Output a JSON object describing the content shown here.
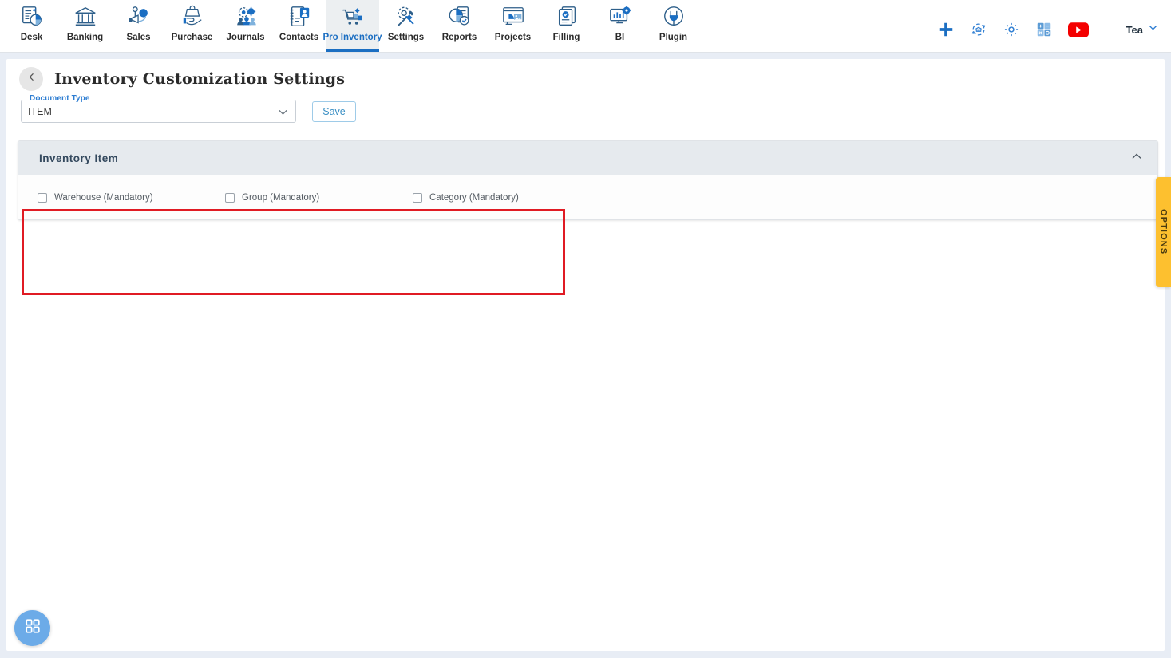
{
  "topnav": {
    "items": [
      {
        "label": "Desk",
        "icon": "desk-chart-icon",
        "active": false
      },
      {
        "label": "Banking",
        "icon": "bank-building-icon",
        "active": false
      },
      {
        "label": "Sales",
        "icon": "megaphone-sales-icon",
        "active": false
      },
      {
        "label": "Purchase",
        "icon": "purchase-hand-bag-icon",
        "active": false
      },
      {
        "label": "Journals",
        "icon": "journals-gear-people-icon",
        "active": false
      },
      {
        "label": "Contacts",
        "icon": "contacts-book-icon",
        "active": false
      },
      {
        "label": "Pro Inventory",
        "icon": "inventory-cart-icon",
        "active": true
      },
      {
        "label": "Settings",
        "icon": "settings-tools-icon",
        "active": false
      },
      {
        "label": "Reports",
        "icon": "reports-pie-doc-icon",
        "active": false
      },
      {
        "label": "Projects",
        "icon": "projects-board-icon",
        "active": false
      },
      {
        "label": "Filling",
        "icon": "filling-docs-icon",
        "active": false
      },
      {
        "label": "BI",
        "icon": "bi-monitor-icon",
        "active": false
      },
      {
        "label": "Plugin",
        "icon": "plugin-plug-icon",
        "active": false
      }
    ],
    "right_icons": [
      {
        "name": "add-plus-icon",
        "color": "#1b6ec2"
      },
      {
        "name": "bank-sync-icon",
        "color": "#2d7dd2"
      },
      {
        "name": "gear-settings-icon",
        "color": "#2d7dd2"
      },
      {
        "name": "calculator-icon",
        "color": "#5b9bd5"
      },
      {
        "name": "youtube-icon",
        "color": "#f40000"
      }
    ],
    "user": {
      "name": "Tea",
      "chevron": "chevron-down-icon"
    }
  },
  "page": {
    "back_icon": "chevron-left-icon",
    "title": "Inventory Customization Settings",
    "document_type": {
      "label": "Document Type",
      "value": "ITEM",
      "chevron": "chevron-down-icon"
    },
    "save_label": "Save"
  },
  "card": {
    "title": "Inventory Item",
    "collapse_icon": "chevron-up-icon",
    "checkboxes": [
      {
        "label": "Warehouse (Mandatory)",
        "checked": false
      },
      {
        "label": "Group (Mandatory)",
        "checked": false
      },
      {
        "label": "Category (Mandatory)",
        "checked": false
      }
    ]
  },
  "options_tab": {
    "label": "OPTIONS",
    "color": "#fdc02f"
  },
  "fab": {
    "icon": "grid-apps-icon",
    "color": "#6cabe8"
  },
  "highlight": {
    "color": "#e01b24"
  }
}
